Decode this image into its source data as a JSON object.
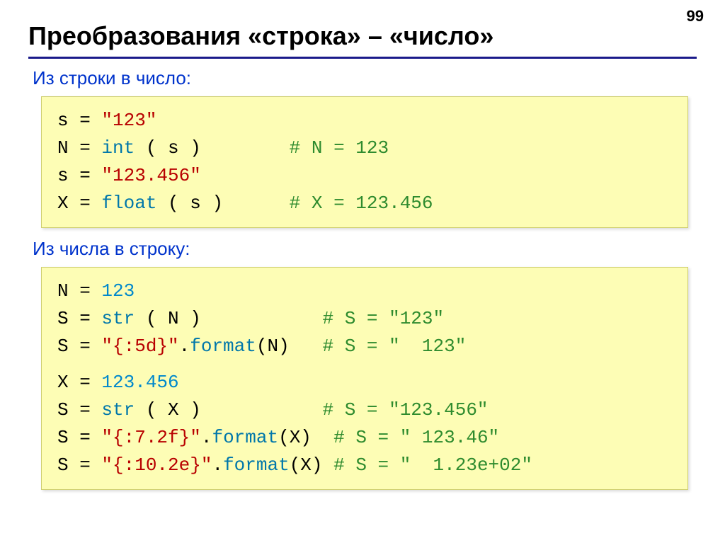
{
  "page_number": "99",
  "title": "Преобразования «строка» – «число»",
  "label_from_string": "Из строки в число:",
  "label_from_number": "Из числа в строку:",
  "box1": {
    "l1a": "s = ",
    "l1b": "\"123\"",
    "l2a": "N = ",
    "l2b": "int",
    "l2c": " ( s )        ",
    "l2d": "# N = 123",
    "l3a": "s = ",
    "l3b": "\"123.456\"",
    "l4a": "X = ",
    "l4b": "float",
    "l4c": " ( s )      ",
    "l4d": "# X = 123.456"
  },
  "box2": {
    "l1a": "N = ",
    "l1b": "123",
    "l2a": "S = ",
    "l2b": "str",
    "l2c": " ( N )           ",
    "l2d": "# S = \"123\"",
    "l3a": "S = ",
    "l3b": "\"{:5d}\"",
    "l3c": ".",
    "l3d": "format",
    "l3e": "(N)   ",
    "l3f": "# S = \"  123\"",
    "l4a": "X = ",
    "l4b": "123.456",
    "l5a": "S = ",
    "l5b": "str",
    "l5c": " ( X )           ",
    "l5d": "# S = \"123.456\"",
    "l6a": "S = ",
    "l6b": "\"{:7.2f}\"",
    "l6c": ".",
    "l6d": "format",
    "l6e": "(X)  ",
    "l6f": "# S = \" 123.46\"",
    "l7a": "S = ",
    "l7b": "\"{:10.2e}\"",
    "l7c": ".",
    "l7d": "format",
    "l7e": "(X) ",
    "l7f": "# S = \"  1.23e+02\""
  }
}
